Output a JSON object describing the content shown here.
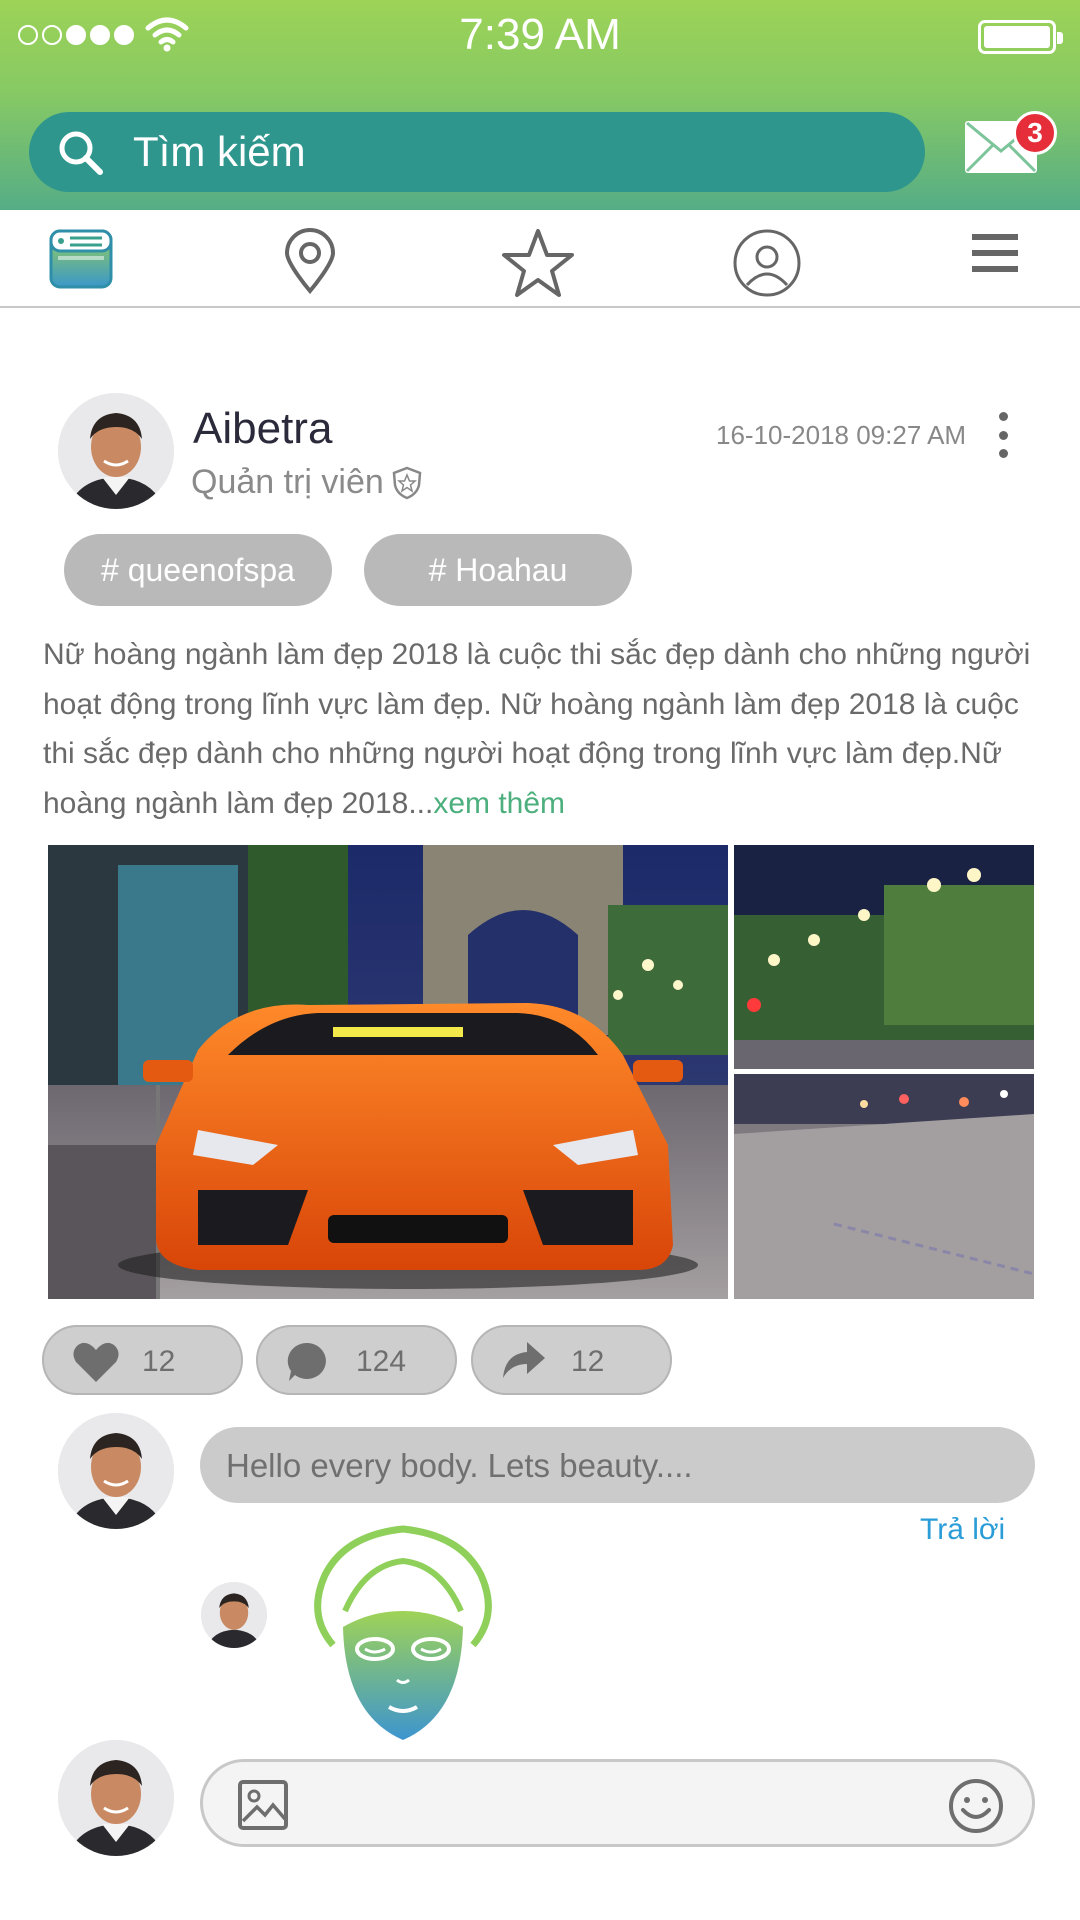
{
  "status_bar": {
    "time": "7:39 AM"
  },
  "search": {
    "placeholder": "Tìm kiếm"
  },
  "messages": {
    "badge_count": "3"
  },
  "tabs": [
    {
      "icon": "news-feed-icon",
      "active": true
    },
    {
      "icon": "location-pin-icon",
      "active": false
    },
    {
      "icon": "star-icon",
      "active": false
    },
    {
      "icon": "profile-icon",
      "active": false
    },
    {
      "icon": "hamburger-menu-icon",
      "active": false
    }
  ],
  "post": {
    "author": "Aibetra",
    "role": "Quản trị viên",
    "timestamp": "16-10-2018 09:27 AM",
    "tags": [
      "# queenofspa",
      "# Hoahau"
    ],
    "text": "Nữ hoàng ngành làm đẹp 2018 là cuộc thi sắc đẹp dành cho những người hoạt động trong lĩnh vực làm đẹp. Nữ hoàng ngành làm đẹp 2018 là cuộc thi sắc đẹp dành cho những người hoạt động trong lĩnh vực làm đẹp.Nữ hoàng ngành làm đẹp 2018...",
    "see_more": "xem thêm",
    "reactions": {
      "likes": "12",
      "comments": "124",
      "shares": "12"
    }
  },
  "comments": {
    "first": "Hello every body. Lets beauty....",
    "reply_label": "Trả lời"
  },
  "composer": {
    "placeholder": ""
  },
  "colors": {
    "header_top": "#9dd357",
    "header_bottom": "#56ad86",
    "search_bg": "#2e968d",
    "badge": "#e52e3a",
    "link_green": "#4caf7d",
    "reply_blue": "#2a9dd8"
  }
}
